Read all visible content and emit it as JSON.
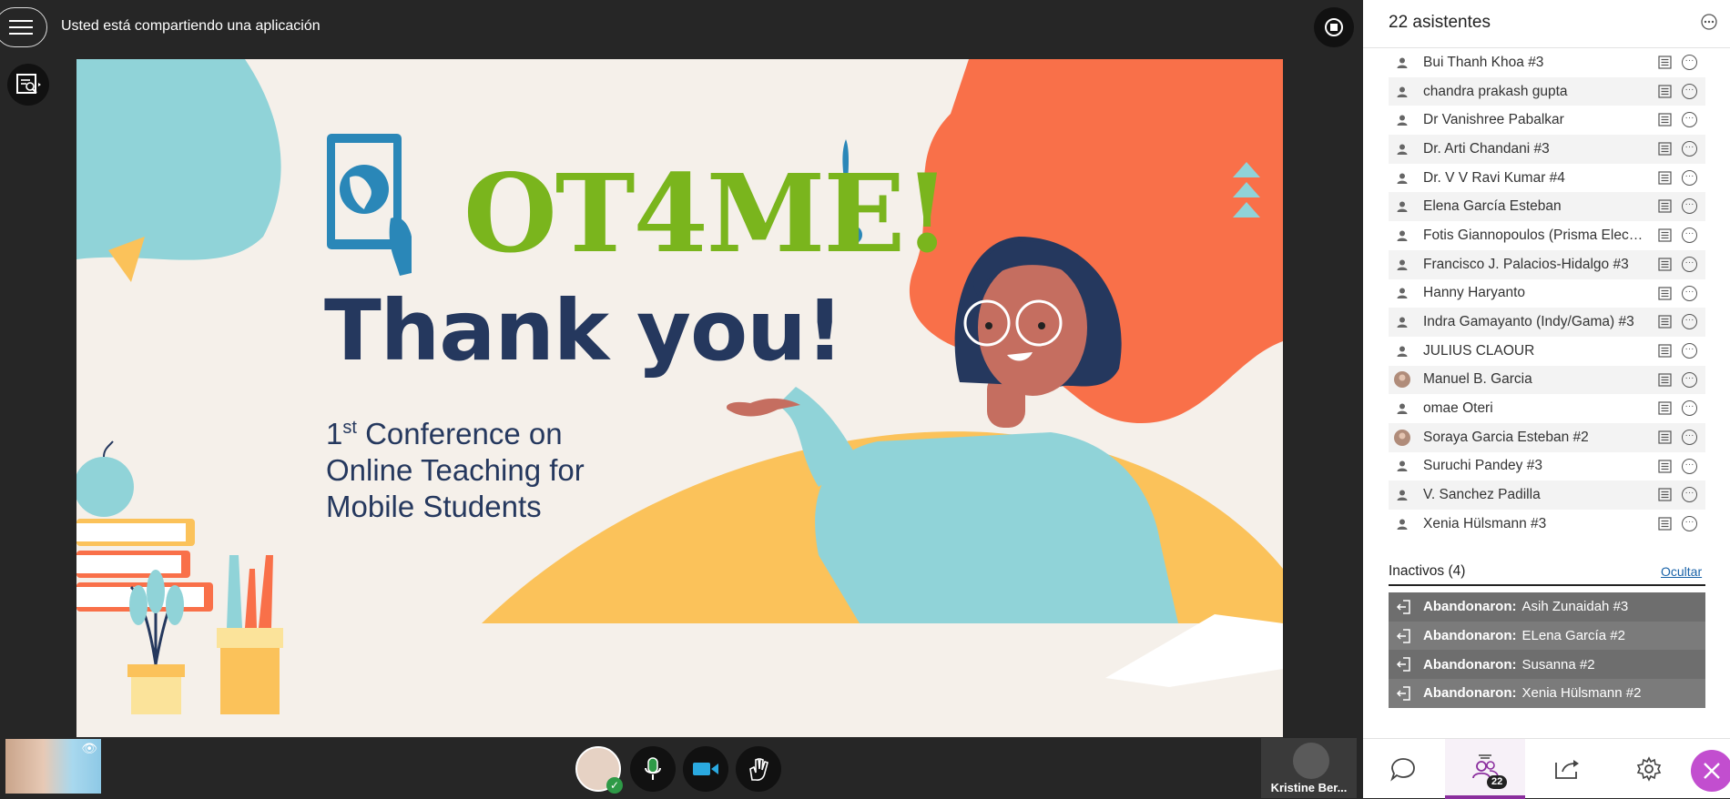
{
  "topbar": {
    "sharing_text": "Usted está compartiendo una aplicación"
  },
  "slide": {
    "logo_text": "OT4ME!",
    "thanks": "Thank you!",
    "conference_ordinal": "1",
    "conference_ordinal_sup": "st",
    "conference_line1_rest": " Conference on",
    "conference_line2": "Online Teaching for",
    "conference_line3": "Mobile Students"
  },
  "bottombar": {
    "presenter_name": "Kristine Ber..."
  },
  "panel": {
    "title": "22 asistentes",
    "attendees": [
      {
        "name": "Bui Thanh Khoa #3",
        "avatar": "person-icon"
      },
      {
        "name": "chandra prakash gupta",
        "avatar": "person-icon"
      },
      {
        "name": "Dr Vanishree Pabalkar",
        "avatar": "person-icon"
      },
      {
        "name": "Dr. Arti Chandani #3",
        "avatar": "person-icon"
      },
      {
        "name": "Dr. V V Ravi Kumar #4",
        "avatar": "person-icon"
      },
      {
        "name": "Elena García Esteban",
        "avatar": "person-icon"
      },
      {
        "name": "Fotis Giannopoulos (Prisma Electronics)",
        "avatar": "person-icon"
      },
      {
        "name": "Francisco J. Palacios-Hidalgo #3",
        "avatar": "person-icon"
      },
      {
        "name": "Hanny Haryanto",
        "avatar": "person-icon"
      },
      {
        "name": "Indra Gamayanto (Indy/Gama) #3",
        "avatar": "person-icon"
      },
      {
        "name": "JULIUS CLAOUR",
        "avatar": "person-icon"
      },
      {
        "name": "Manuel B. Garcia",
        "avatar": "photo-avatar"
      },
      {
        "name": "omae Oteri",
        "avatar": "person-icon"
      },
      {
        "name": "Soraya Garcia Esteban #2",
        "avatar": "photo-avatar"
      },
      {
        "name": "Suruchi Pandey #3",
        "avatar": "person-icon"
      },
      {
        "name": "V. Sanchez Padilla",
        "avatar": "person-icon"
      },
      {
        "name": "Xenia Hülsmann #3",
        "avatar": "person-icon"
      }
    ],
    "inactive_title": "Inactivos (4)",
    "inactive_hide": "Ocultar",
    "inactive": [
      {
        "label": "Abandonaron:",
        "name": "Asih Zunaidah #3"
      },
      {
        "label": "Abandonaron:",
        "name": "ELena García #2"
      },
      {
        "label": "Abandonaron:",
        "name": "Susanna #2"
      },
      {
        "label": "Abandonaron:",
        "name": "Xenia Hülsmann #2"
      }
    ],
    "participants_count": "22"
  },
  "colors": {
    "accent": "#8b2f9e",
    "close": "#c24ecf",
    "slide_navy": "#25385e",
    "slide_green": "#7ab51d"
  }
}
